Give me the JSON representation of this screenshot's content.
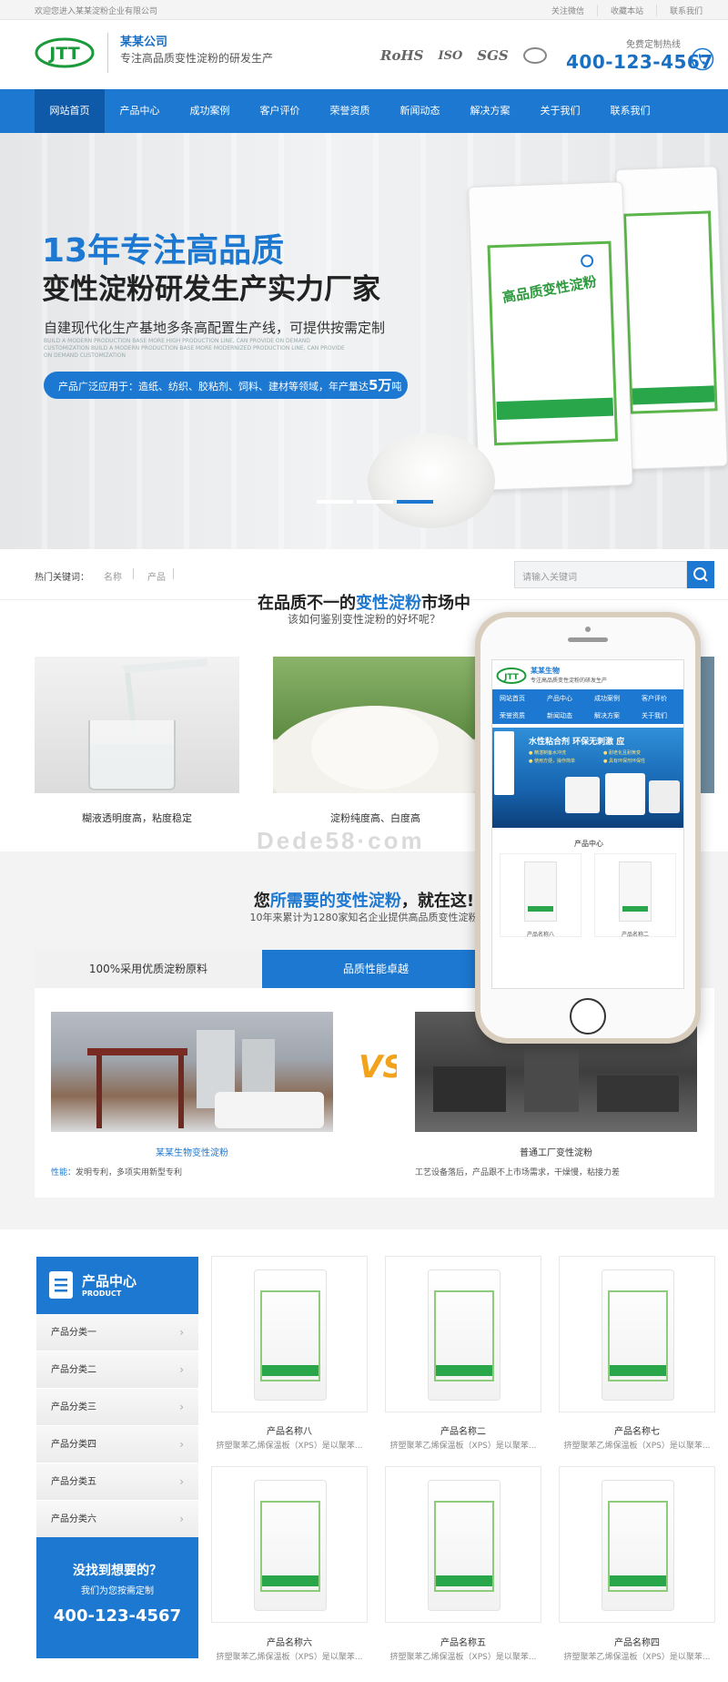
{
  "topbar": {
    "welcome": "欢迎您进入某某淀粉企业有限公司",
    "links": [
      "关注微信",
      "收藏本站",
      "联系我们"
    ]
  },
  "header": {
    "logo_text": "JTT",
    "brand": "某某公司",
    "slogan": "专注高品质变性淀粉的研发生产",
    "certs": [
      "RoHS",
      "ISO",
      "SGS"
    ],
    "hotline_label": "免费定制热线",
    "hotline": "400-123-4567"
  },
  "nav": [
    "网站首页",
    "产品中心",
    "成功案例",
    "客户评价",
    "荣誉资质",
    "新闻动态",
    "解决方案",
    "关于我们",
    "联系我们"
  ],
  "banner": {
    "title1": "13年专注高品质",
    "title2": "变性淀粉研发生产实力厂家",
    "sub": "自建现代化生产基地多条高配置生产线，可提供按需定制",
    "eng": "BUILD A MODERN PRODUCTION BASE MORE HIGH PRODUCTION LINE, CAN PROVIDE ON DEMAND CUSTOMIZATION BUILD A MODERN PRODUCTION BASE MORE MODERNIZED PRODUCTION LINE, CAN PROVIDE ON DEMAND CUSTOMIZATION",
    "pill_text": "产品广泛应用于：造纸、纺织、胶粘剂、饲料、建材等领域，年产量达",
    "pill_big": "5万",
    "pill_unit": "吨",
    "bag_title": "高品质变性淀粉"
  },
  "search": {
    "label": "热门关键词：",
    "keywords": [
      "名称",
      "产品"
    ],
    "placeholder": "请输入关键词"
  },
  "sec1": {
    "title_a": "在品质不一的",
    "title_b": "变性淀粉",
    "title_c": "市场中",
    "sub": "该如何鉴别变性淀粉的好坏呢？",
    "captions": [
      "糊液透明度高，粘度稳定",
      "淀粉纯度高、白度高"
    ]
  },
  "watermark": "Dede58·com",
  "sec2": {
    "title_a": "您",
    "title_b": "所需要的变性淀粉",
    "title_c": "，就在这!",
    "sub": "10年来累计为1280家知名企业提供高品质变性淀粉",
    "tab1": "100%采用优质淀粉原料",
    "tab2": "品质性能卓越",
    "vs": "VS",
    "left_name": "某某生物变性淀粉",
    "left_desc_label": "性能：",
    "left_desc": "发明专利，多项实用新型专利",
    "right_name": "普通工厂变性淀粉",
    "right_desc": "工艺设备落后，产品跟不上市场需求，干燥慢，粘接力差"
  },
  "sidebar": {
    "title": "产品中心",
    "title_en": "PRODUCT",
    "items": [
      "产品分类一",
      "产品分类二",
      "产品分类三",
      "产品分类四",
      "产品分类五",
      "产品分类六"
    ],
    "cta_title": "没找到想要的？",
    "cta_sub": "我们为您按需定制",
    "cta_phone": "400-123-4567"
  },
  "products": [
    {
      "name": "产品名称八",
      "desc": "挤塑聚苯乙烯保温板（XPS）是以聚苯..."
    },
    {
      "name": "产品名称二",
      "desc": "挤塑聚苯乙烯保温板（XPS）是以聚苯..."
    },
    {
      "name": "产品名称七",
      "desc": "挤塑聚苯乙烯保温板（XPS）是以聚苯..."
    },
    {
      "name": "产品名称六",
      "desc": "挤塑聚苯乙烯保温板（XPS）是以聚苯..."
    },
    {
      "name": "产品名称五",
      "desc": "挤塑聚苯乙烯保温板（XPS）是以聚苯..."
    },
    {
      "name": "产品名称四",
      "desc": "挤塑聚苯乙烯保温板（XPS）是以聚苯..."
    }
  ],
  "phone": {
    "brand": "某某生物",
    "slogan": "专注高品质变性淀粉的研发生产",
    "nav": [
      "网站首页",
      "产品中心",
      "成功案例",
      "客户评价",
      "荣誉资质",
      "新闻动态",
      "解决方案",
      "关于我们"
    ],
    "banner_text": "水性粘合剂 环保无刺激 应",
    "banner_small": [
      "● 精湛制备水冲洗",
      "● 耐老化且耐黄变",
      "● 使用方便，操作简单",
      "● 具有环保剂环保性"
    ],
    "section": "产品中心",
    "products": [
      "产品名称八",
      "产品名称二"
    ]
  },
  "colors": {
    "primary": "#1c78d0",
    "dark": "#0e5aa8",
    "green": "#2aa64a"
  }
}
